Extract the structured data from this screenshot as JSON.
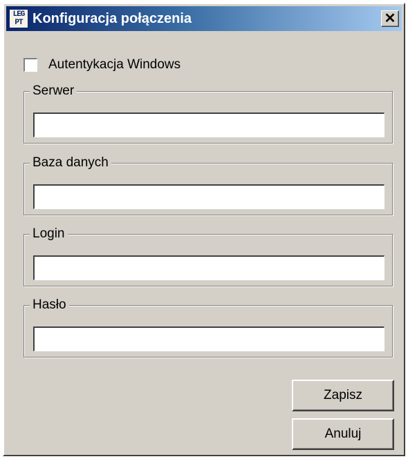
{
  "window": {
    "title": "Konfiguracja połączenia",
    "icon": {
      "name": "app-logo-icon",
      "line1": "LEG",
      "line2": "PT"
    },
    "close_glyph": "✕"
  },
  "auth": {
    "label": "Autentykacja Windows",
    "checked": false
  },
  "fields": {
    "server": {
      "label": "Serwer",
      "value": ""
    },
    "database": {
      "label": "Baza danych",
      "value": ""
    },
    "login": {
      "label": "Login",
      "value": ""
    },
    "password": {
      "label": "Hasło",
      "value": ""
    }
  },
  "buttons": {
    "save": "Zapisz",
    "cancel": "Anuluj"
  },
  "colors": {
    "face": "#d4d0c8",
    "titlebar_start": "#0a246a",
    "titlebar_end": "#a6caf0"
  }
}
